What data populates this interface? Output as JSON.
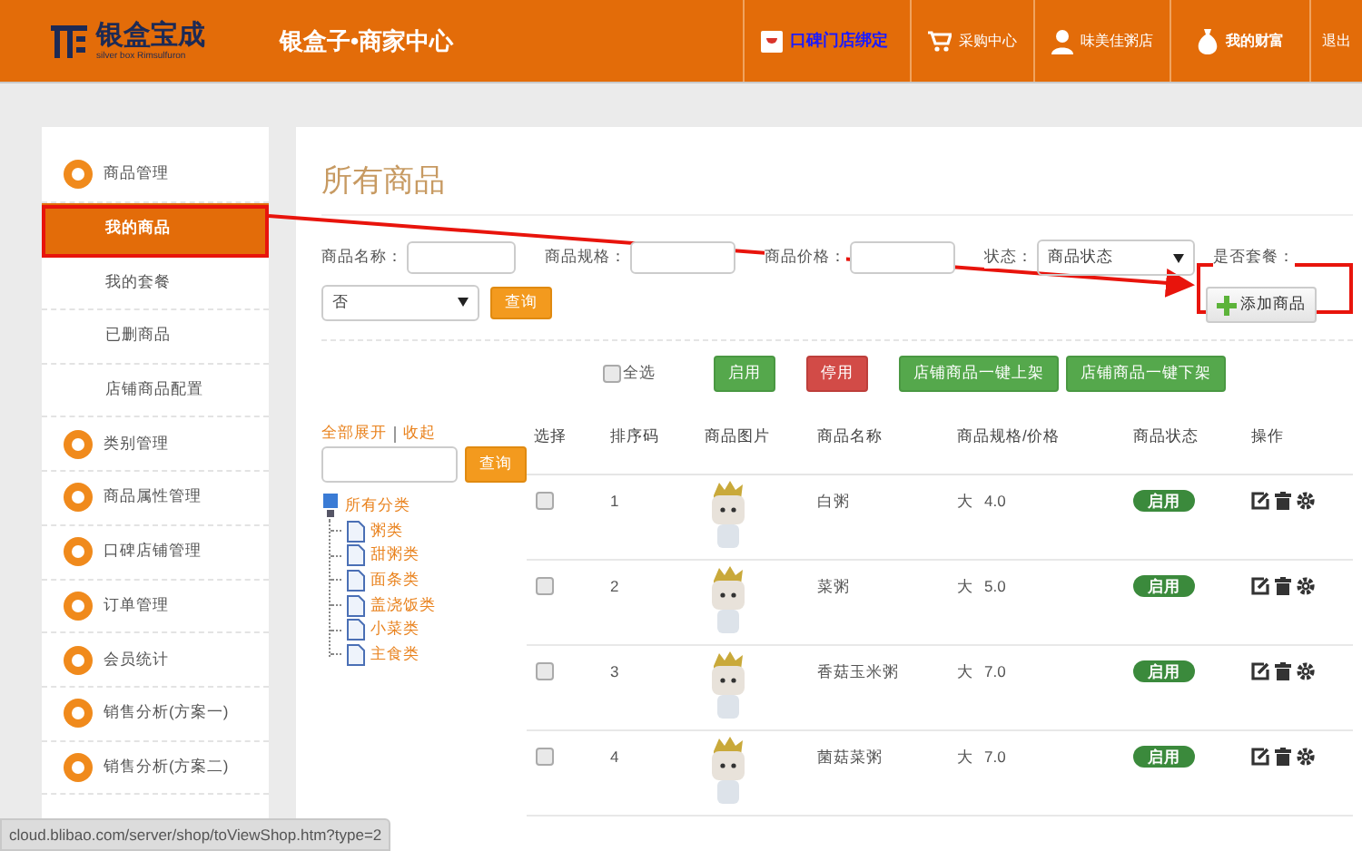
{
  "header": {
    "logo_text": "银盒宝成",
    "logo_sub": "silver box Rimsulfuron",
    "title": "银盒子•商家中心",
    "nav": [
      {
        "label": "口碑门店绑定",
        "kind": "koubei"
      },
      {
        "label": "采购中心",
        "kind": "cart"
      },
      {
        "label": "味美佳粥店",
        "kind": "user"
      },
      {
        "label": "我的财富",
        "kind": "money"
      },
      {
        "label": "退出",
        "kind": "plain"
      }
    ]
  },
  "sidebar": {
    "items": [
      {
        "label": "商品管理",
        "kind": "group",
        "selected": false
      },
      {
        "label": "我的商品",
        "kind": "sub",
        "selected": true
      },
      {
        "label": "我的套餐",
        "kind": "sub",
        "selected": false
      },
      {
        "label": "已删商品",
        "kind": "sub",
        "selected": false
      },
      {
        "label": "店铺商品配置",
        "kind": "sub",
        "selected": false
      },
      {
        "label": "类别管理",
        "kind": "group",
        "selected": false
      },
      {
        "label": "商品属性管理",
        "kind": "group",
        "selected": false
      },
      {
        "label": "口碑店铺管理",
        "kind": "group",
        "selected": false
      },
      {
        "label": "订单管理",
        "kind": "group",
        "selected": false
      },
      {
        "label": "会员统计",
        "kind": "group",
        "selected": false
      },
      {
        "label": "销售分析(方案一)",
        "kind": "group",
        "selected": false
      },
      {
        "label": "销售分析(方案二)",
        "kind": "group",
        "selected": false
      }
    ]
  },
  "main": {
    "title": "所有商品",
    "filters": [
      {
        "label": "商品名称：",
        "kind": "input"
      },
      {
        "label": "商品规格：",
        "kind": "input"
      },
      {
        "label": "商品价格：",
        "kind": "input"
      },
      {
        "label": "状态：",
        "kind": "select",
        "value": "商品状态"
      },
      {
        "label": "是否套餐：",
        "kind": "label"
      }
    ],
    "package_select": {
      "value": "否"
    },
    "query_button": "查询",
    "add_button": "添加商品",
    "select_all": {
      "label": "全选",
      "checked": false
    },
    "actions": [
      {
        "label": "启用",
        "kind": "enable"
      },
      {
        "label": "停用",
        "kind": "disable"
      },
      {
        "label": "店铺商品一键上架",
        "kind": "enable"
      },
      {
        "label": "店铺商品一键下架",
        "kind": "enable"
      }
    ],
    "tree": {
      "expand_all": "全部展开",
      "collapse": "收起",
      "search_button": "查询",
      "root": {
        "label": "所有分类",
        "children": [
          {
            "label": "粥类"
          },
          {
            "label": "甜粥类"
          },
          {
            "label": "面条类"
          },
          {
            "label": "盖浇饭类"
          },
          {
            "label": "小菜类"
          },
          {
            "label": "主食类"
          }
        ]
      }
    },
    "table": {
      "columns": [
        "选择",
        "排序码",
        "商品图片",
        "商品名称",
        "商品规格/价格",
        "商品状态",
        "操作"
      ],
      "rows": [
        {
          "checked": false,
          "sort": "1",
          "name": "白粥",
          "spec": "大",
          "price": "4.0",
          "status": "启用"
        },
        {
          "checked": false,
          "sort": "2",
          "name": "菜粥",
          "spec": "大",
          "price": "5.0",
          "status": "启用"
        },
        {
          "checked": false,
          "sort": "3",
          "name": "香菇玉米粥",
          "spec": "大",
          "price": "7.0",
          "status": "启用"
        },
        {
          "checked": false,
          "sort": "4",
          "name": "菌菇菜粥",
          "spec": "大",
          "price": "7.0",
          "status": "启用"
        }
      ]
    }
  },
  "status_bar": {
    "url": "cloud.blibao.com/server/shop/toViewShop.htm?type=2"
  }
}
